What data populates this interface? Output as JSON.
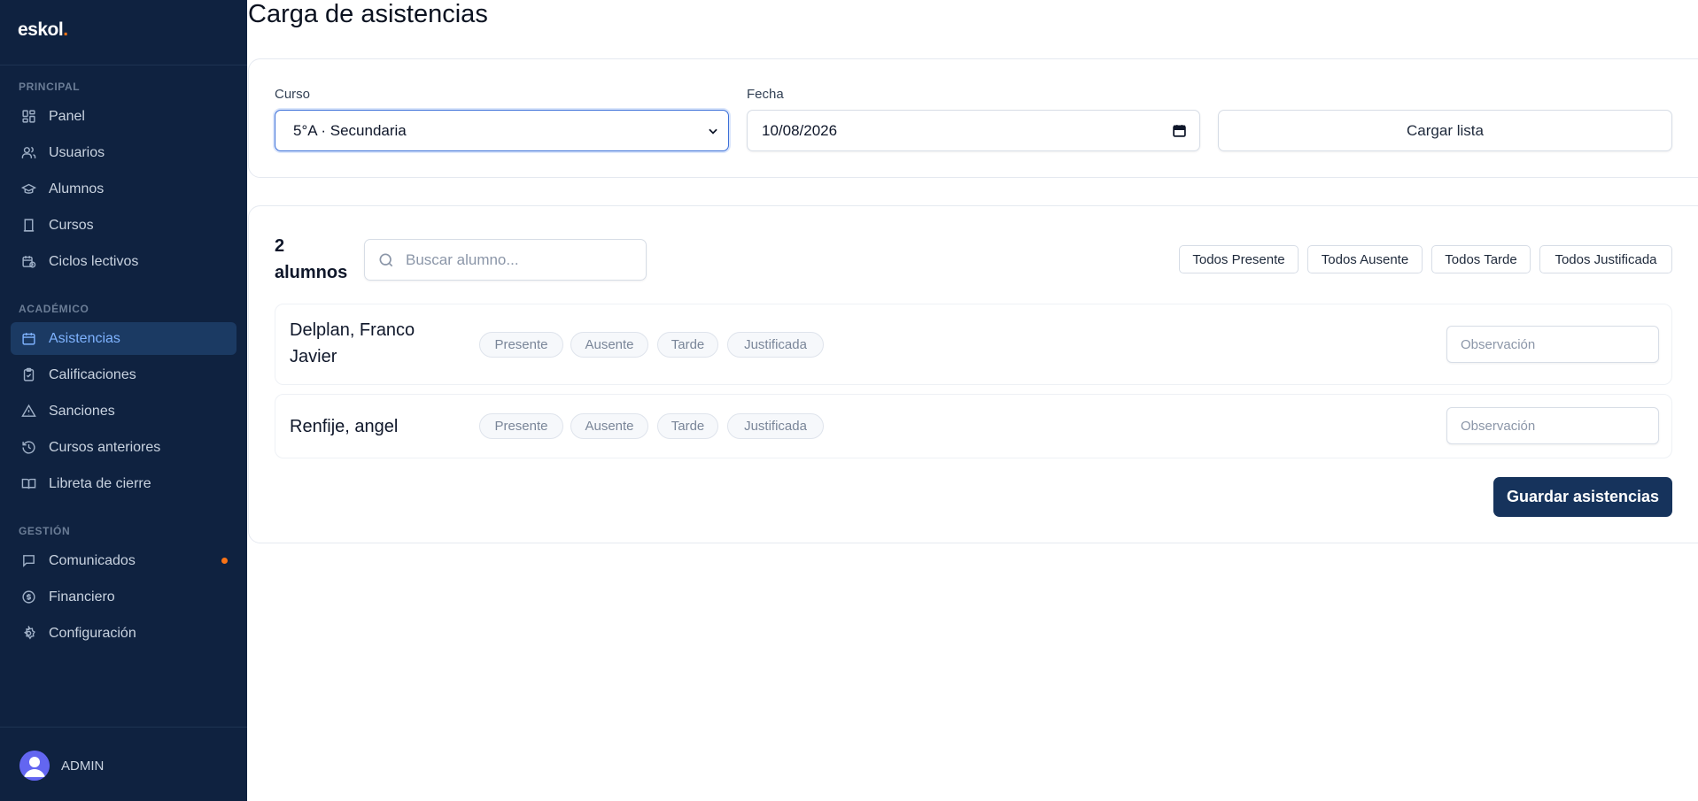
{
  "app": {
    "brand": "eskol",
    "brand_dot": "."
  },
  "sidebar": {
    "sections": [
      {
        "label": "PRINCIPAL"
      },
      {
        "label": "ACADÉMICO"
      },
      {
        "label": "GESTIÓN"
      }
    ],
    "items": [
      {
        "label": "Panel",
        "icon": "dashboard-icon"
      },
      {
        "label": "Usuarios",
        "icon": "users-icon"
      },
      {
        "label": "Alumnos",
        "icon": "graduation-cap-icon"
      },
      {
        "label": "Cursos",
        "icon": "book-icon"
      },
      {
        "label": "Ciclos lectivos",
        "icon": "calendar-clock-icon"
      },
      {
        "label": "Asistencias",
        "icon": "calendar-check-icon",
        "active": true
      },
      {
        "label": "Calificaciones",
        "icon": "clipboard-icon"
      },
      {
        "label": "Sanciones",
        "icon": "warning-icon"
      },
      {
        "label": "Cursos anteriores",
        "icon": "history-icon"
      },
      {
        "label": "Libreta de cierre",
        "icon": "open-book-icon"
      },
      {
        "label": "Comunicados",
        "icon": "message-icon",
        "notification": true
      },
      {
        "label": "Financiero",
        "icon": "coin-icon"
      },
      {
        "label": "Configuración",
        "icon": "gear-icon"
      }
    ],
    "user": {
      "name": "ADMIN"
    }
  },
  "page": {
    "title": "Carga de asistencias"
  },
  "filters": {
    "course_label": "Curso",
    "course_value": "5°A · Secundaria",
    "date_label": "Fecha",
    "date_value": "10/08/2026",
    "load_button": "Cargar lista"
  },
  "list": {
    "count_number": "2",
    "count_label": "alumnos",
    "search_placeholder": "Buscar alumno...",
    "bulk_actions": [
      "Todos Presente",
      "Todos Ausente",
      "Todos Tarde",
      "Todos Justificada"
    ],
    "status_options": [
      "Presente",
      "Ausente",
      "Tarde",
      "Justificada"
    ],
    "observation_placeholder": "Observación",
    "students": [
      {
        "name": "Delplan, Franco Javier"
      },
      {
        "name": "Renfije, angel"
      }
    ],
    "save_button": "Guardar asistencias"
  },
  "colors": {
    "sidebar_bg": "#0f2240",
    "active_item_bg": "#1b3a63",
    "active_item_text": "#7fb3ff",
    "primary_button": "#16335c",
    "notification_dot": "#f97316"
  }
}
